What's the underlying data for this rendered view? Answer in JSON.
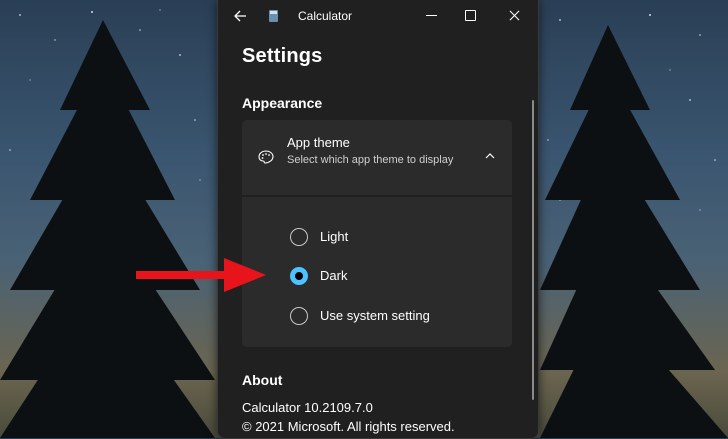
{
  "window": {
    "title": "Calculator",
    "back_icon": "back-arrow-icon",
    "controls": [
      "minimize-icon",
      "maximize-icon",
      "close-icon"
    ]
  },
  "settings": {
    "heading": "Settings",
    "appearance": {
      "section_title": "Appearance",
      "app_theme": {
        "title": "App theme",
        "description": "Select which app theme to display",
        "icon": "palette-icon",
        "expanded": true,
        "options": [
          {
            "label": "Light",
            "selected": false
          },
          {
            "label": "Dark",
            "selected": true
          },
          {
            "label": "Use system setting",
            "selected": false
          }
        ]
      }
    },
    "about": {
      "section_title": "About",
      "version": "Calculator 10.2109.7.0",
      "copyright": "© 2021 Microsoft. All rights reserved."
    }
  },
  "colors": {
    "accent": "#4cc2ff",
    "window_bg": "#202020",
    "card_bg": "#2b2b2b",
    "annotation_arrow": "#e8141b"
  }
}
